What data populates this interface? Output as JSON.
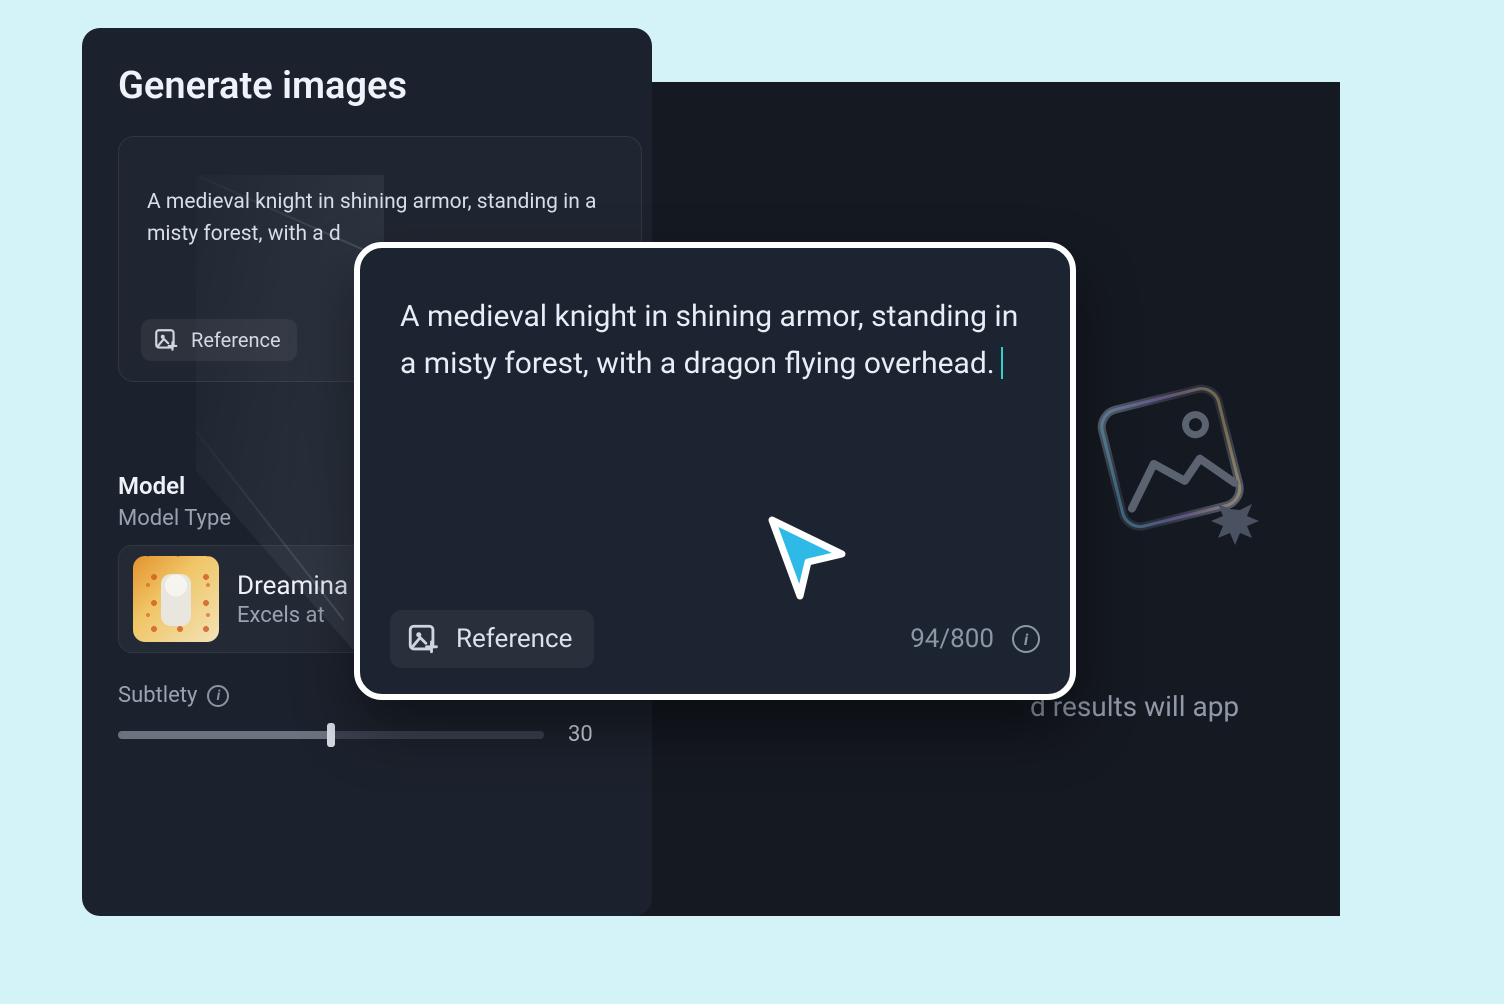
{
  "panel": {
    "title": "Generate images",
    "small_prompt": "A medieval knight in shining armor, standing in a misty forest, with a d",
    "reference_label": "Reference",
    "model_section_label": "Model",
    "model_type_label": "Model Type",
    "model_name": "Dreamina",
    "model_desc": "Excels at",
    "subtlety_label": "Subtlety",
    "subtlety_value": "30"
  },
  "callout": {
    "prompt": "A medieval knight in shining armor, standing in a misty forest, with a dragon flying overhead.",
    "reference_label": "Reference",
    "char_count": "94",
    "char_limit": "800"
  },
  "right": {
    "placeholder_text_fragment": "d results will app"
  }
}
